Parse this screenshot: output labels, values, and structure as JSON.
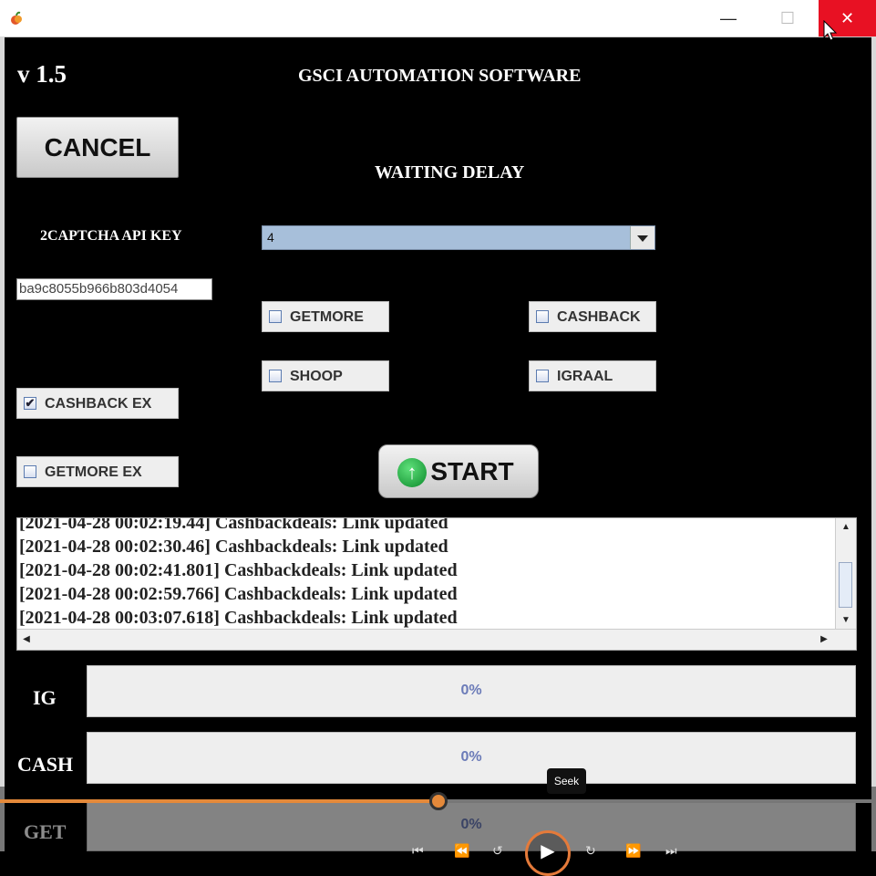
{
  "window": {
    "minimize_glyph": "—",
    "maximize_glyph": "☐",
    "close_glyph": "✕",
    "app_icon": "app-fruit-icon"
  },
  "header": {
    "version": "v 1.5",
    "title": "GSCI AUTOMATION SOFTWARE",
    "delay_title": "WAITING DELAY"
  },
  "controls": {
    "cancel_label": "CANCEL",
    "api_key_label": "2CAPTCHA API KEY",
    "api_key_value": "ba9c8055b966b803d4054",
    "delay_selected": "4",
    "start_label": "START",
    "start_icon_glyph": "↑"
  },
  "checkboxes": {
    "getmore": {
      "label": "GETMORE",
      "checked": false
    },
    "cashback": {
      "label": "CASHBACK",
      "checked": false
    },
    "shoop": {
      "label": "SHOOP",
      "checked": false
    },
    "igraal": {
      "label": "IGRAAL",
      "checked": false
    },
    "cashback_ex": {
      "label": "CASHBACK EX",
      "checked": true,
      "mark": "✔"
    },
    "getmore_ex": {
      "label": "GETMORE EX",
      "checked": false
    }
  },
  "log": {
    "lines": [
      "[2021-04-28 00:02:19.44]  Cashbackdeals:  Link updated",
      "[2021-04-28 00:02:30.46]  Cashbackdeals:  Link updated",
      "[2021-04-28 00:02:41.801]  Cashbackdeals:  Link updated",
      "[2021-04-28 00:02:59.766]  Cashbackdeals:  Link updated",
      "[2021-04-28 00:03:07.618]  Cashbackdeals:  Link updated"
    ],
    "scroll_up": "▲",
    "scroll_down": "▼",
    "scroll_left": "◀",
    "scroll_right": "▶"
  },
  "progress": [
    {
      "label": "IG",
      "text": "0%",
      "value": 0
    },
    {
      "label": "CASH",
      "text": "0%",
      "value": 0
    },
    {
      "label": "GET",
      "text": "0%",
      "value": 0
    }
  ],
  "video_player": {
    "seek_tooltip": "Seek",
    "progress": 0.5,
    "accent": "#e4893a",
    "play_glyph": "▶"
  }
}
